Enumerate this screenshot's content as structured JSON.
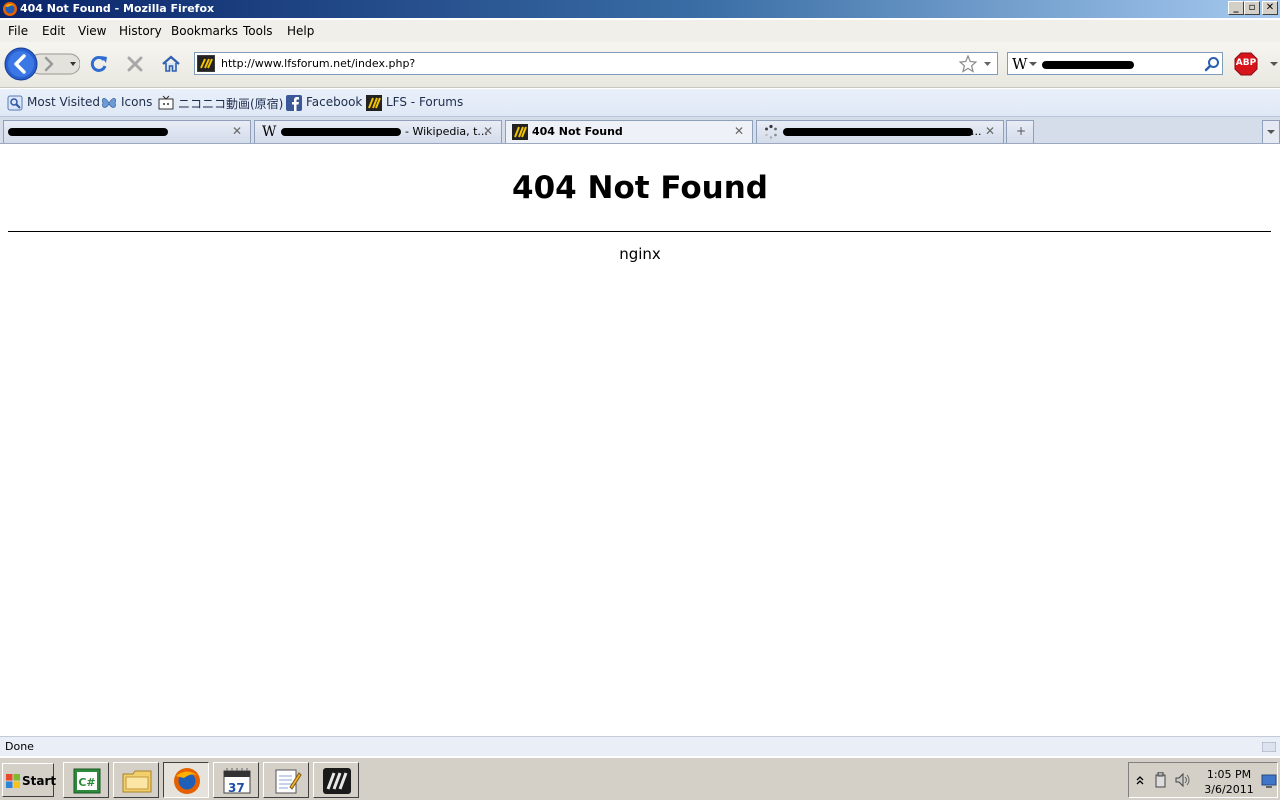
{
  "window": {
    "title": "404 Not Found - Mozilla Firefox",
    "buttons": {
      "minimize": "_",
      "maximize": "▫",
      "close": "✕"
    }
  },
  "menu": {
    "items": [
      "File",
      "Edit",
      "View",
      "History",
      "Bookmarks",
      "Tools",
      "Help"
    ]
  },
  "toolbar": {
    "url": "http://www.lfsforum.net/index.php?",
    "search_engine_icon": "W",
    "adblock_label": "ABP"
  },
  "bookmarks": [
    {
      "label": "Most Visited",
      "icon": "most-visited-icon"
    },
    {
      "label": "Icons",
      "icon": "butterfly-icon"
    },
    {
      "label": "ニコニコ動画(原宿)",
      "icon": "nicovideo-icon"
    },
    {
      "label": "Facebook",
      "icon": "facebook-icon"
    },
    {
      "label": "LFS - Forums",
      "icon": "lfs-icon"
    }
  ],
  "tabs": [
    {
      "label": "",
      "active": false
    },
    {
      "label": "- Wikipedia, t...",
      "active": false
    },
    {
      "label": "404 Not Found",
      "active": true
    },
    {
      "label": "...",
      "active": false
    }
  ],
  "page": {
    "heading": "404 Not Found",
    "server": "nginx"
  },
  "status": {
    "text": "Done"
  },
  "taskbar": {
    "start_label": "Start",
    "calendar_day": "37",
    "clock_time": "1:05 PM",
    "clock_date": "3/6/2011"
  },
  "colors": {
    "titlebar_start": "#0a246a",
    "titlebar_end": "#a6caf0",
    "adblock_red": "#d7141a"
  }
}
